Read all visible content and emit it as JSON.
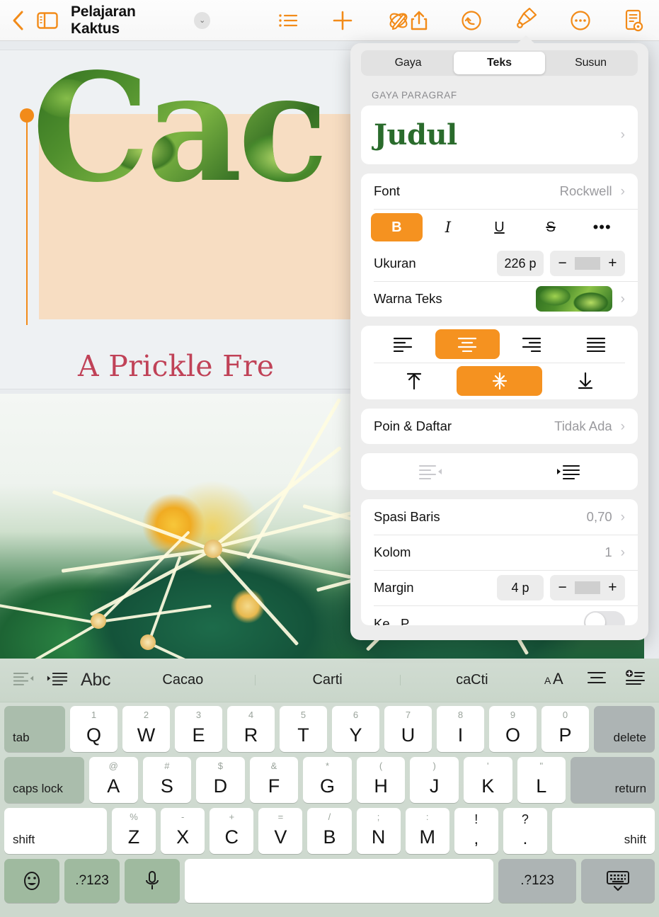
{
  "toolbar": {
    "back_icon": "chevron-left-icon",
    "sidebar_icon": "sidebar-toggle-icon",
    "title": "Pelajaran Kaktus",
    "title_chevron": "⌄",
    "items": [
      {
        "name": "list-view-icon",
        "label": "Daftar"
      },
      {
        "name": "insert-add-icon",
        "label": "Tambah"
      },
      {
        "name": "media-draw-icon",
        "label": "Gambar"
      },
      {
        "name": "share-icon",
        "label": "Bagikan"
      },
      {
        "name": "undo-icon",
        "label": "Urung"
      },
      {
        "name": "format-brush-icon",
        "label": "Format"
      },
      {
        "name": "more-options-icon",
        "label": "Lainnya"
      },
      {
        "name": "document-options-icon",
        "label": "Dokumen"
      }
    ]
  },
  "canvas": {
    "hero_title": "Cac",
    "hero_subtitle": "A Prickle Fre",
    "selection_handle": "text-selection-handle"
  },
  "panel": {
    "tabs": [
      {
        "label": "Gaya",
        "active": false
      },
      {
        "label": "Teks",
        "active": true
      },
      {
        "label": "Susun",
        "active": false
      }
    ],
    "section_label": "GAYA PARAGRAF",
    "paragraph_style": "Judul",
    "font": {
      "label": "Font",
      "value": "Rockwell"
    },
    "format_buttons": [
      {
        "name": "bold-button",
        "glyph": "B",
        "active": true
      },
      {
        "name": "italic-button",
        "glyph": "I",
        "active": false
      },
      {
        "name": "underline-button",
        "glyph": "U",
        "active": false
      },
      {
        "name": "strikethrough-button",
        "glyph": "S",
        "active": false
      },
      {
        "name": "more-text-options-button",
        "glyph": "•••",
        "active": false
      }
    ],
    "size": {
      "label": "Ukuran",
      "value": "226 p",
      "minus": "−",
      "plus": "+"
    },
    "text_color": {
      "label": "Warna Teks",
      "swatch": "image-fill-green-leaves"
    },
    "alignment": {
      "horizontal": [
        {
          "name": "align-left-button",
          "active": false
        },
        {
          "name": "align-center-button",
          "active": true
        },
        {
          "name": "align-right-button",
          "active": false
        },
        {
          "name": "align-justify-button",
          "active": false
        }
      ],
      "vertical": [
        {
          "name": "align-top-button",
          "active": false
        },
        {
          "name": "align-middle-button",
          "active": true
        },
        {
          "name": "align-bottom-button",
          "active": false
        }
      ]
    },
    "bullets": {
      "label": "Poin & Daftar",
      "value": "Tidak Ada"
    },
    "indent": [
      {
        "name": "decrease-indent-button",
        "enabled": false
      },
      {
        "name": "increase-indent-button",
        "enabled": true
      }
    ],
    "line_spacing": {
      "label": "Spasi Baris",
      "value": "0,70"
    },
    "columns": {
      "label": "Kolom",
      "value": "1"
    },
    "margin": {
      "label": "Margin",
      "value": "4 p",
      "minus": "−",
      "plus": "+"
    },
    "cut_off_row": {
      "label": "Ke..  P..."
    }
  },
  "keyboard": {
    "bar": {
      "left_icons": [
        {
          "name": "decrease-indent-icon"
        },
        {
          "name": "increase-indent-icon"
        }
      ],
      "abc_label": "Abc",
      "predictions": [
        "Cacao",
        "Carti",
        "caCti"
      ],
      "right_icons": [
        {
          "name": "text-size-icon",
          "label": "AA"
        },
        {
          "name": "paragraph-align-icon"
        },
        {
          "name": "insert-list-icon"
        }
      ]
    },
    "row1": {
      "tab": "tab",
      "keys": [
        {
          "sup": "1",
          "main": "Q"
        },
        {
          "sup": "2",
          "main": "W"
        },
        {
          "sup": "3",
          "main": "E"
        },
        {
          "sup": "4",
          "main": "R"
        },
        {
          "sup": "5",
          "main": "T"
        },
        {
          "sup": "6",
          "main": "Y"
        },
        {
          "sup": "7",
          "main": "U"
        },
        {
          "sup": "8",
          "main": "I"
        },
        {
          "sup": "9",
          "main": "O"
        },
        {
          "sup": "0",
          "main": "P"
        }
      ],
      "delete": "delete"
    },
    "row2": {
      "caps": "caps lock",
      "keys": [
        {
          "sup": "@",
          "main": "A"
        },
        {
          "sup": "#",
          "main": "S"
        },
        {
          "sup": "$",
          "main": "D"
        },
        {
          "sup": "&",
          "main": "F"
        },
        {
          "sup": "*",
          "main": "G"
        },
        {
          "sup": "(",
          "main": "H"
        },
        {
          "sup": ")",
          "main": "J"
        },
        {
          "sup": "'",
          "main": "K"
        },
        {
          "sup": "\"",
          "main": "L"
        }
      ],
      "return": "return"
    },
    "row3": {
      "shift_left": "shift",
      "keys": [
        {
          "sup": "%",
          "main": "Z"
        },
        {
          "sup": "-",
          "main": "X"
        },
        {
          "sup": "+",
          "main": "C"
        },
        {
          "sup": "=",
          "main": "V"
        },
        {
          "sup": "/",
          "main": "B"
        },
        {
          "sup": ";",
          "main": "N"
        },
        {
          "sup": ":",
          "main": "M"
        },
        {
          "sup": "!",
          "main": ",",
          "dual": true
        },
        {
          "sup": "?",
          "main": ".",
          "dual": true
        }
      ],
      "shift_right": "shift"
    },
    "row4": {
      "emoji_icon": "emoji-smiley-icon",
      "num_left": ".?123",
      "mic_icon": "microphone-icon",
      "space": "",
      "num_right": ".?123",
      "hide_keyboard_icon": "hide-keyboard-icon"
    }
  },
  "colors": {
    "accent": "#F28B19",
    "panel_active": "#F59220",
    "style_green": "#2A6B2C",
    "subtitle_red": "#C04257",
    "hero_band": "#F7DDC2"
  }
}
